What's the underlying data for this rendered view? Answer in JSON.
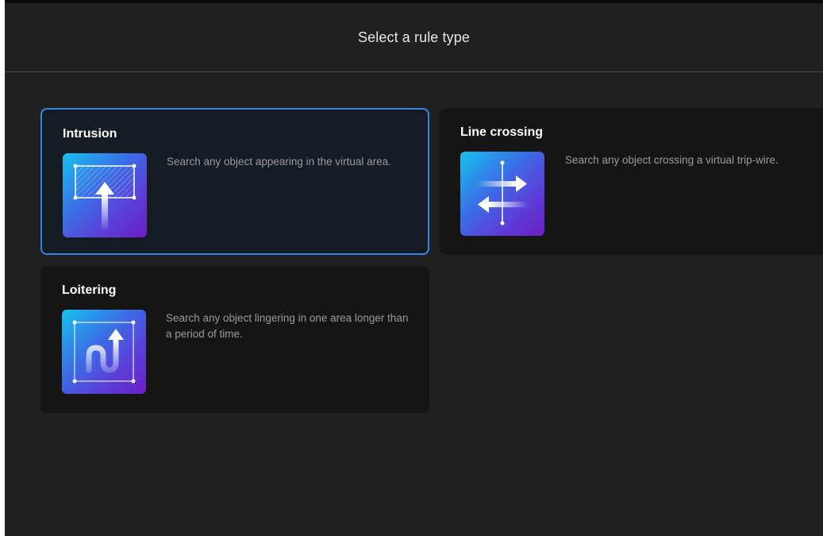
{
  "header": {
    "title": "Select a rule type"
  },
  "rules": [
    {
      "title": "Intrusion",
      "description": "Search any object appearing in the virtual area.",
      "icon": "intrusion-icon",
      "selected": true
    },
    {
      "title": "Line crossing",
      "description": "Search any object crossing a virtual trip-wire.",
      "icon": "line-crossing-icon",
      "selected": false
    },
    {
      "title": "Loitering",
      "description": "Search any object lingering in one area longer than a period of time.",
      "icon": "loitering-icon",
      "selected": false
    }
  ],
  "colors": {
    "background": "#202020",
    "card": "#151515",
    "selected_border": "#2f86e6",
    "icon_gradient_start": "#16c2ee",
    "icon_gradient_end": "#6b1ec4"
  }
}
